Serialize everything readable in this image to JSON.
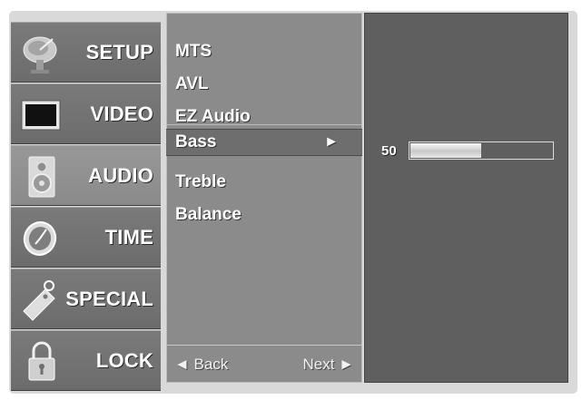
{
  "categories": [
    {
      "label": "SETUP",
      "icon": "satellite-dish-icon"
    },
    {
      "label": "VIDEO",
      "icon": "tv-screen-icon"
    },
    {
      "label": "AUDIO",
      "icon": "speaker-icon",
      "selected": true
    },
    {
      "label": "TIME",
      "icon": "clock-icon"
    },
    {
      "label": "SPECIAL",
      "icon": "tag-icon"
    },
    {
      "label": "LOCK",
      "icon": "padlock-icon"
    }
  ],
  "menu": {
    "items": [
      "MTS",
      "AVL",
      "EZ Audio",
      "Bass",
      "Treble",
      "Balance"
    ],
    "selected_item": "Bass",
    "selected_arrow": "►",
    "back_label": "◄ Back",
    "next_label": "Next ►"
  },
  "bass": {
    "value": "50",
    "level": 50,
    "max": 100
  },
  "colors": {
    "osd_background": "#d9d9d9",
    "menu_panel": "#8b8b8b",
    "right_panel": "#5f5f5f",
    "text": "#ffffff"
  }
}
